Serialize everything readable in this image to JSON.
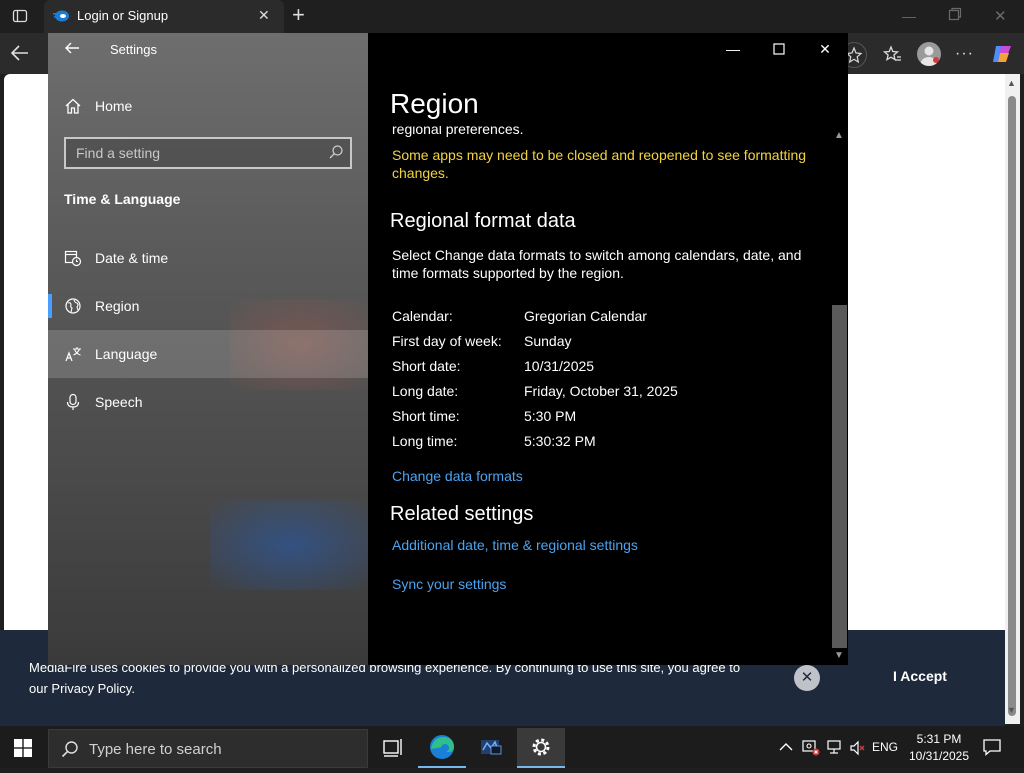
{
  "browser": {
    "tab_title": "Login or Signup",
    "new_tab_symbol": "+",
    "cookie": {
      "text": "MediaFire uses cookies to provide you with a personalized browsing experience. By continuing to use this site, you agree to our Privacy Policy.",
      "accept_label": "I Accept",
      "close_symbol": "✕"
    }
  },
  "settings": {
    "window_title": "Settings",
    "search_placeholder": "Find a setting",
    "section_heading": "Time & Language",
    "nav": {
      "home": "Home",
      "date_time": "Date & time",
      "region": "Region",
      "language": "Language",
      "speech": "Speech"
    },
    "page": {
      "title": "Region",
      "cut_text": "regional preferences.",
      "note": "Some apps may need to be closed and reopened to see formatting changes.",
      "regional_heading": "Regional format data",
      "description": "Select Change data formats to switch among calendars, date, and time formats supported by the region.",
      "formats": [
        {
          "label": "Calendar:",
          "value": "Gregorian Calendar"
        },
        {
          "label": "First day of week:",
          "value": "Sunday"
        },
        {
          "label": "Short date:",
          "value": "10/31/2025"
        },
        {
          "label": "Long date:",
          "value": "Friday, October 31, 2025"
        },
        {
          "label": "Short time:",
          "value": "5:30 PM"
        },
        {
          "label": "Long time:",
          "value": "5:30:32 PM"
        }
      ],
      "change_link": "Change data formats",
      "related_heading": "Related settings",
      "related_links": [
        "Additional date, time & regional settings",
        "Sync your settings"
      ]
    }
  },
  "taskbar": {
    "search_placeholder": "Type here to search",
    "language": "ENG",
    "time": "5:31 PM",
    "date": "10/31/2025"
  },
  "colors": {
    "accent_link": "#4ba3f0",
    "note_yellow": "#f2d43f",
    "cookie_bar": "#1e2a3b"
  }
}
